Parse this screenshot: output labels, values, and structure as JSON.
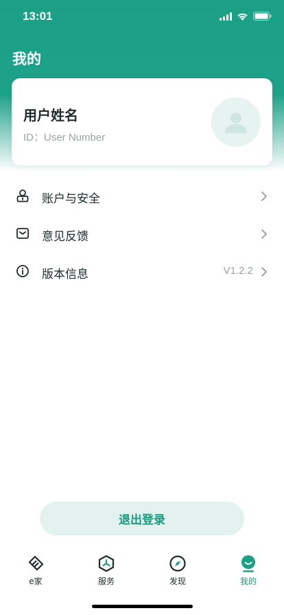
{
  "status_bar": {
    "time": "13:01"
  },
  "page_title": "我的",
  "profile": {
    "name": "用户姓名",
    "id_text": "ID：User Number"
  },
  "menu": [
    {
      "label": "账户与安全",
      "value": "",
      "icon": "user-lock-icon"
    },
    {
      "label": "意见反馈",
      "value": "",
      "icon": "mail-icon"
    },
    {
      "label": "版本信息",
      "value": "V1.2.2",
      "icon": "info-icon"
    }
  ],
  "logout_label": "退出登录",
  "tabs": [
    {
      "label": "e家",
      "icon": "ehome-icon",
      "active": false
    },
    {
      "label": "服务",
      "icon": "service-icon",
      "active": false
    },
    {
      "label": "发现",
      "icon": "compass-icon",
      "active": false
    },
    {
      "label": "我的",
      "icon": "smile-icon",
      "active": true
    }
  ],
  "colors": {
    "accent": "#1ba086",
    "accent_light": "#e3f2ee",
    "muted": "#9aa3a3"
  }
}
